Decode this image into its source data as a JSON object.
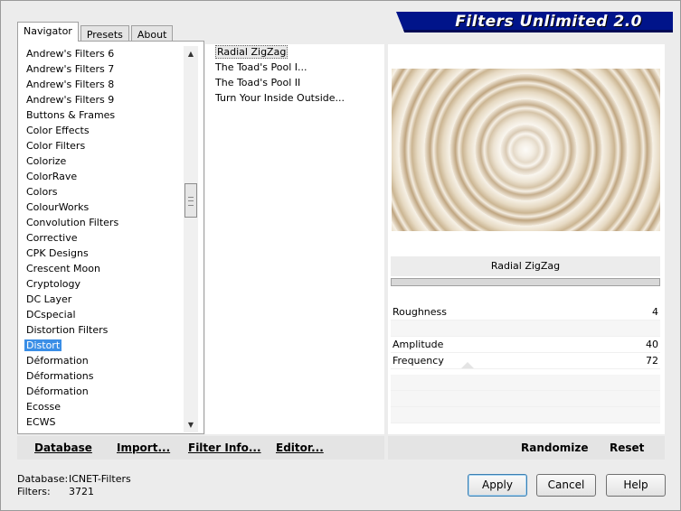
{
  "tabs": [
    {
      "label": "Navigator",
      "active": true
    },
    {
      "label": "Presets",
      "active": false
    },
    {
      "label": "About",
      "active": false
    }
  ],
  "banner": {
    "title": "Filters Unlimited 2.0"
  },
  "categories": [
    "Andrew's Filters 6",
    "Andrew's Filters 7",
    "Andrew's Filters 8",
    "Andrew's Filters 9",
    "Buttons & Frames",
    "Color Effects",
    "Color Filters",
    "Colorize",
    "ColorRave",
    "Colors",
    "ColourWorks",
    "Convolution Filters",
    "Corrective",
    "CPK Designs",
    "Crescent Moon",
    "Cryptology",
    "DC Layer",
    "DCspecial",
    "Distortion Filters",
    "Distort",
    "Déformation",
    "Déformations",
    "Déformation",
    "Ecosse",
    "ECWS"
  ],
  "selected_category": "Distort",
  "filters": [
    "Radial ZigZag",
    "The Toad's Pool I...",
    "The Toad's Pool II",
    "Turn Your Inside Outside..."
  ],
  "selected_filter": "Radial ZigZag",
  "parameters": {
    "title": "Radial ZigZag",
    "rows": [
      {
        "label": "Roughness",
        "value": "4"
      },
      {
        "label": "",
        "value": ""
      },
      {
        "label": "Amplitude",
        "value": "40"
      },
      {
        "label": "Frequency",
        "value": "72"
      }
    ]
  },
  "left_toolbar": {
    "database": "Database",
    "import": "Import...",
    "filter_info": "Filter Info...",
    "editor": "Editor..."
  },
  "right_toolbar": {
    "randomize": "Randomize",
    "reset": "Reset"
  },
  "status": {
    "database_label": "Database:",
    "database_value": "ICNET-Filters",
    "filters_label": "Filters:",
    "filters_value": "3721"
  },
  "buttons": {
    "apply": "Apply",
    "cancel": "Cancel",
    "help": "Help"
  },
  "scrollbar": {
    "up": "▲",
    "down": "▼"
  }
}
